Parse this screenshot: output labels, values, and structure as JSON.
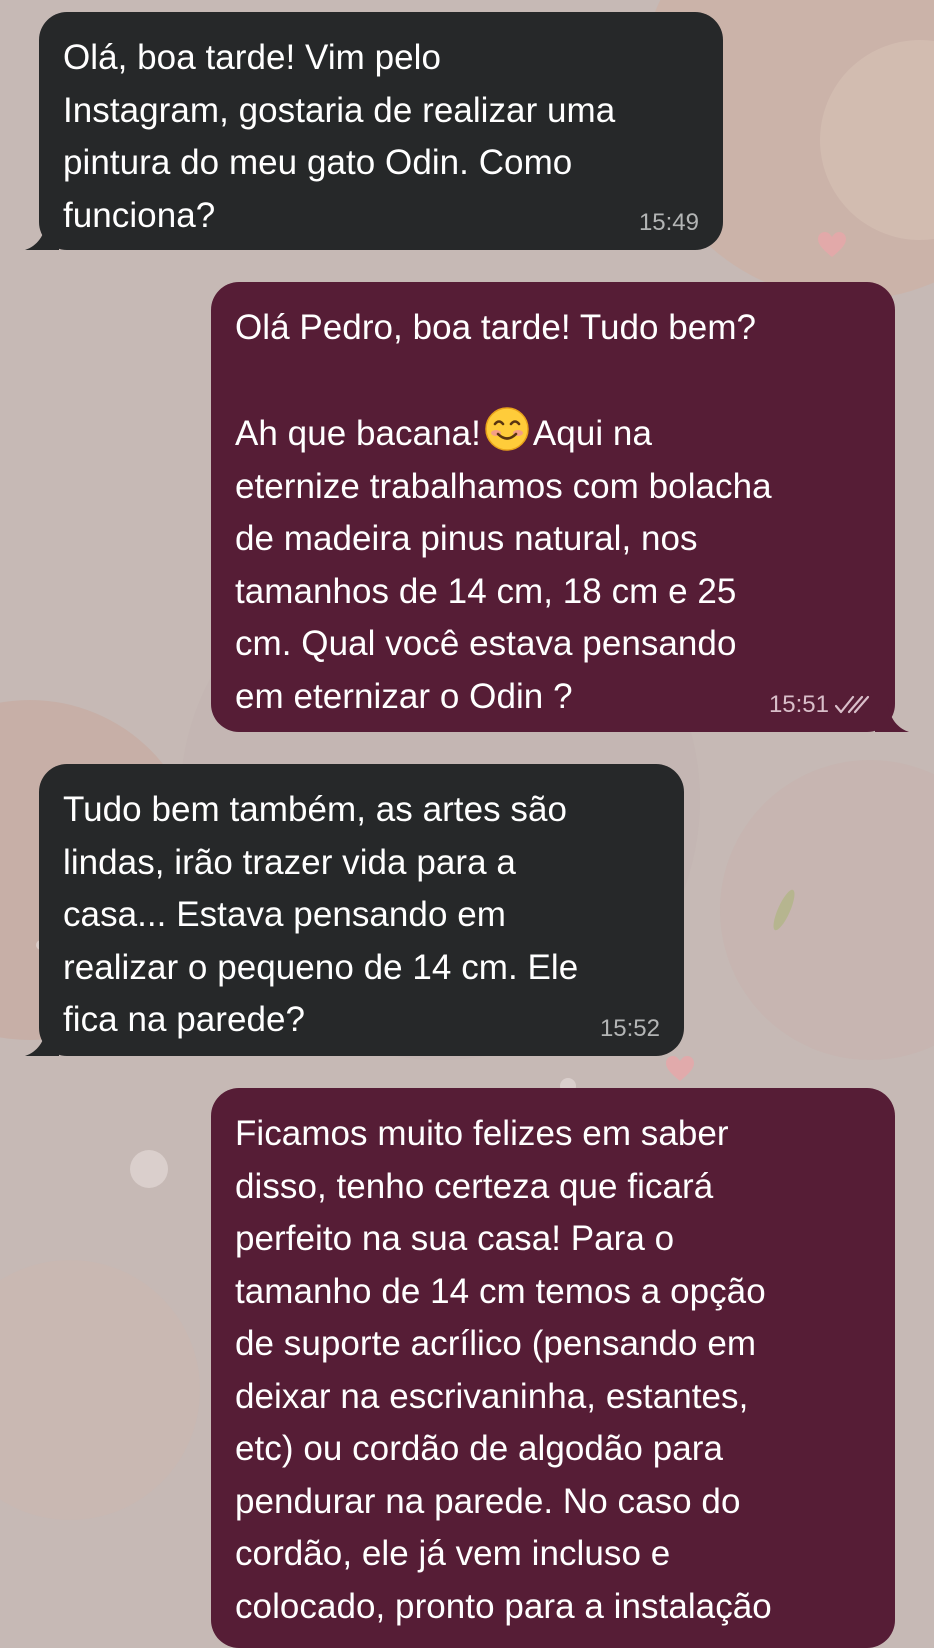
{
  "conversation": {
    "messages": [
      {
        "direction": "incoming",
        "text": "Olá, boa tarde! Vim pelo\nInstagram, gostaria de realizar uma\npintura do meu gato Odin. Como\nfunciona?",
        "time": "15:49"
      },
      {
        "direction": "outgoing",
        "text_line1": "Olá Pedro, boa tarde! Tudo bem?",
        "text_pre_emoji": "Ah que bacana!",
        "emoji": "smiling-face-emoji",
        "text_post_emoji": "Aqui na\neternize trabalhamos com bolacha\nde madeira pinus natural, nos\ntamanhos de 14 cm, 18 cm e 25\ncm. Qual você estava pensando\nem eternizar o Odin ?",
        "time": "15:51",
        "status": "read"
      },
      {
        "direction": "incoming",
        "text": "Tudo bem também, as artes são\nlindas, irão trazer vida para a\ncasa... Estava pensando em\nrealizar o pequeno de 14 cm. Ele\nfica na parede?",
        "time": "15:52"
      },
      {
        "direction": "outgoing",
        "text": "Ficamos muito felizes em saber\ndisso, tenho certeza que ficará\nperfeito na sua casa! Para o\ntamanho de 14 cm temos a opção\nde suporte acrílico (pensando em\ndeixar na escrivaninha, estantes,\netc) ou cordão de algodão para\npendurar na parede. No caso do\ncordão, ele já vem incluso e\ncolocado, pronto para a instalação"
      }
    ]
  },
  "colors": {
    "incoming_bubble": "#262829",
    "outgoing_bubble": "#561d36",
    "wallpaper": "#c6b9b5",
    "read_ticks": "#d9bfca"
  }
}
